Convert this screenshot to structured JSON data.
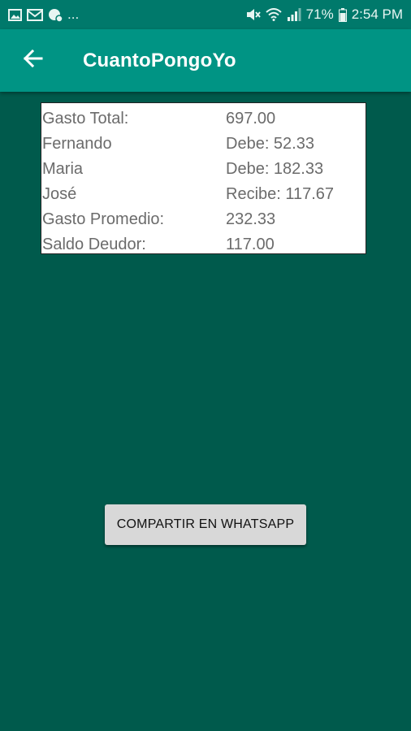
{
  "status_bar": {
    "more_indicator": "...",
    "battery_percent": "71%",
    "time": "2:54 PM",
    "icons": [
      "image-icon",
      "mail-icon",
      "chat-icon",
      "mute-icon",
      "wifi-icon",
      "signal-icon",
      "battery-icon"
    ]
  },
  "app_bar": {
    "title": "CuantoPongoYo",
    "back_icon": "arrow-left-icon"
  },
  "results": {
    "rows": [
      {
        "label": "Gasto Total:",
        "value": "697.00"
      },
      {
        "label": "Fernando",
        "value": "Debe: 52.33"
      },
      {
        "label": "Maria",
        "value": "Debe: 182.33"
      },
      {
        "label": "José",
        "value": "Recibe: 117.67"
      },
      {
        "label": "Gasto Promedio:",
        "value": "232.33"
      },
      {
        "label": "Saldo Deudor:",
        "value": "117.00"
      }
    ]
  },
  "share_button": {
    "label": "COMPARTIR EN WHATSAPP"
  },
  "colors": {
    "background": "#005a4c",
    "app_bar": "#009484",
    "status_bar": "#00796b",
    "button": "#d8d8d8"
  }
}
